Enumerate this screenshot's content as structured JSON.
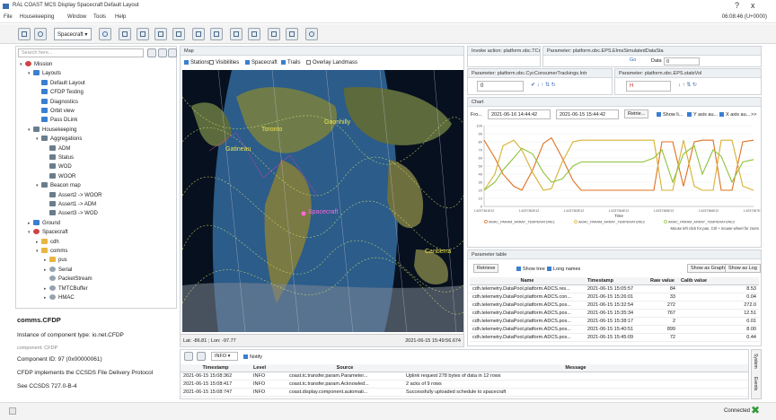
{
  "window": {
    "title": "RAL COAST MCS Display  Spacecraft  Default Layout",
    "clock": "06:08:46 (U+0000)",
    "controls": [
      "?",
      "x"
    ]
  },
  "menu": [
    "File",
    "Housekeeping",
    "Window",
    "Tools",
    "Help"
  ],
  "toolbar": {
    "spacecraft_select": "Spacecraft"
  },
  "nav": {
    "search_placeholder": "Search here...",
    "tree": [
      {
        "label": "Mission",
        "depth": 0,
        "icon": "mission",
        "tw": "▾"
      },
      {
        "label": "Layouts",
        "depth": 1,
        "icon": "folder",
        "tw": "▾"
      },
      {
        "label": "Default Layout",
        "depth": 2,
        "icon": "doc",
        "tw": ""
      },
      {
        "label": "CFDP Testing",
        "depth": 2,
        "icon": "doc",
        "tw": ""
      },
      {
        "label": "Diagnostics",
        "depth": 2,
        "icon": "doc",
        "tw": ""
      },
      {
        "label": "Orbit view",
        "depth": 2,
        "icon": "doc",
        "tw": ""
      },
      {
        "label": "Pass DLink",
        "depth": 2,
        "icon": "doc",
        "tw": ""
      },
      {
        "label": "Housekeeping",
        "depth": 1,
        "icon": "grid",
        "tw": "▾"
      },
      {
        "label": "Aggregations",
        "depth": 2,
        "icon": "grid",
        "tw": "▾"
      },
      {
        "label": "ADM",
        "depth": 3,
        "icon": "grid",
        "tw": ""
      },
      {
        "label": "Status",
        "depth": 3,
        "icon": "grid",
        "tw": ""
      },
      {
        "label": "WOD",
        "depth": 3,
        "icon": "grid",
        "tw": ""
      },
      {
        "label": "WOOR",
        "depth": 3,
        "icon": "grid",
        "tw": ""
      },
      {
        "label": "Beacon map",
        "depth": 2,
        "icon": "grid",
        "tw": "▾"
      },
      {
        "label": "Assert2 -> WOOR",
        "depth": 3,
        "icon": "grid",
        "tw": ""
      },
      {
        "label": "Assert1 -> ADM",
        "depth": 3,
        "icon": "grid",
        "tw": ""
      },
      {
        "label": "Assert3 -> WOD",
        "depth": 3,
        "icon": "grid",
        "tw": ""
      },
      {
        "label": "Ground",
        "depth": 1,
        "icon": "folder",
        "tw": "▸"
      },
      {
        "label": "Spacecraft",
        "depth": 1,
        "icon": "mission",
        "tw": "▾"
      },
      {
        "label": "cdh",
        "depth": 2,
        "icon": "folder-y",
        "tw": "▸"
      },
      {
        "label": "comms",
        "depth": 2,
        "icon": "folder-y",
        "tw": "▾"
      },
      {
        "label": "pus",
        "depth": 3,
        "icon": "folder-y",
        "tw": "▸"
      },
      {
        "label": "Serial",
        "depth": 3,
        "icon": "gear",
        "tw": "▸"
      },
      {
        "label": "PacketStream",
        "depth": 3,
        "icon": "gear",
        "tw": ""
      },
      {
        "label": "TMTCBuffer",
        "depth": 3,
        "icon": "gear",
        "tw": "▸"
      },
      {
        "label": "HMAC",
        "depth": 3,
        "icon": "gear",
        "tw": "▸"
      }
    ]
  },
  "description": {
    "title": "comms.CFDP",
    "lines": [
      "Instance of component type: io.net.CFDP",
      "component: CFDP",
      "Component ID: 97 (0x00000061)",
      "CFDP implements the CCSDS File Delivery Protocol",
      "See CCSDS 727.0-B-4"
    ]
  },
  "map": {
    "title": "Map",
    "checks": [
      {
        "label": "Stations",
        "on": true
      },
      {
        "label": "Visibilities",
        "on": false
      },
      {
        "label": "Spacecraft",
        "on": true
      },
      {
        "label": "Trails",
        "on": true
      },
      {
        "label": "Overlay Landmass",
        "on": false
      }
    ],
    "labels": [
      "Goonhilly",
      "Toronto",
      "Gatineau",
      "Spacecraft",
      "Canberra"
    ],
    "coords": "Lat: -86.81 ; Lon: -97.77",
    "timestamp": "2021-06-15 15:49:56.674"
  },
  "param_panels": {
    "top_left": "Invoke action: platform.obc.TCmeesd",
    "top_right": "Parameter: platform.obc.EPS.ElmsSimulatedDataSta",
    "p1": "Parameter: platform.obc.CycConsumerTrackings.Intr",
    "p2": "Parameter: platform.obc.EPS.statsVol",
    "p1_value": "0",
    "p2_value": "H",
    "data_label": "Data",
    "data_value": "0",
    "go_label": "Go"
  },
  "chart": {
    "title": "Chart",
    "from_label": "Fro...",
    "from": "2021-06-16 14:44:42",
    "to": "2021-06-15 15:44:42",
    "retrieve": "Retrie...",
    "opts": [
      "Show li...",
      "Y axis au...",
      "X axis au..."
    ],
    "more": ">>",
    "xlabel": "Time",
    "hint": "Mouse left click for pan, Ctrl + mouse wheel for zoom",
    "legend": [
      "AMAC_PARAM_ARRAY_TEMPERATURE1",
      "AMAC_PARAM_ARRAY_TEMPERATURE2",
      "AMAC_PARAM_ARRAY_TEMPERATURE3"
    ],
    "colors": [
      "#e07020",
      "#d8b030",
      "#8fc23a"
    ],
    "y_ticks": [
      "100",
      "90",
      "80",
      "70",
      "60",
      "50",
      "40",
      "30",
      "20",
      "10",
      "0"
    ],
    "x_ticks": [
      "1.6237361E12",
      "1.6237362E12",
      "1.6237363E12",
      "1.6237364E12",
      "1.6237365E12",
      "1.6237366E12",
      "1.6237367E12"
    ]
  },
  "chart_data": {
    "type": "line",
    "title": "",
    "xlabel": "Time",
    "ylabel": "",
    "ylim": [
      0,
      100
    ],
    "x": [
      0,
      4,
      7,
      11,
      14,
      18,
      22,
      25,
      29,
      33,
      36,
      40,
      44,
      48,
      52,
      56,
      59,
      63,
      66,
      70,
      74,
      78,
      81,
      85,
      88,
      92,
      96,
      100
    ],
    "series": [
      {
        "name": "AMAC_PARAM_ARRAY_TEMPERATURE1",
        "values": [
          82,
          60,
          40,
          25,
          20,
          45,
          78,
          85,
          60,
          32,
          20,
          20,
          20,
          20,
          20,
          20,
          20,
          20,
          80,
          80,
          25,
          80,
          82,
          82,
          20,
          20,
          80,
          82
        ]
      },
      {
        "name": "AMAC_PARAM_ARRAY_TEMPERATURE2",
        "values": [
          20,
          40,
          75,
          82,
          70,
          42,
          20,
          22,
          55,
          80,
          82,
          82,
          82,
          82,
          82,
          82,
          82,
          82,
          20,
          20,
          82,
          25,
          20,
          20,
          82,
          82,
          25,
          20
        ]
      },
      {
        "name": "AMAC_PARAM_ARRAY_TEMPERATURE3",
        "values": [
          20,
          30,
          45,
          60,
          72,
          65,
          42,
          30,
          34,
          50,
          55,
          55,
          55,
          55,
          55,
          55,
          55,
          60,
          70,
          30,
          65,
          75,
          40,
          70,
          62,
          30,
          55,
          58
        ]
      }
    ]
  },
  "ptable": {
    "title": "Parameter table",
    "retrieve": "Retrieve",
    "show_tree": "Show tree",
    "long_names": "Long names",
    "show_graph": "Show as Graph",
    "show_log": "Show as Log",
    "headers": [
      "Name",
      "Timestamp",
      "Raw value",
      "Calib value"
    ],
    "rows": [
      [
        "cdh.telemetry.DataPool.platform.ADCS.res...",
        "2021-06-15 15:05:57",
        "84",
        "8.53"
      ],
      [
        "cdh.telemetry.DataPool.platform.ADCS.con...",
        "2021-06-15 15:26:01",
        "33",
        "0.04"
      ],
      [
        "cdh.telemetry.DataPool.platform.ADCS.pos...",
        "2021-06-15 15:32:54",
        "272",
        "272.0"
      ],
      [
        "cdh.telemetry.DataPool.platform.ADCS.pos...",
        "2021-06-15 15:35:34",
        "767",
        "12.51"
      ],
      [
        "cdh.telemetry.DataPool.platform.ADCS.pos...",
        "2021-06-15 15:38:17",
        "2",
        "0.01"
      ],
      [
        "cdh.telemetry.DataPool.platform.ADCS.pos...",
        "2021-06-15 15:40:51",
        "899",
        "8.00"
      ],
      [
        "cdh.telemetry.DataPool.platform.ADCS.pos...",
        "2021-06-15 15:45:09",
        "72",
        "0.44"
      ]
    ]
  },
  "log": {
    "level_select": "INFO",
    "notify": "Notify",
    "headers": [
      "Timestamp",
      "Level",
      "Source",
      "Message"
    ],
    "rows": [
      [
        "2021-06-15 15:08:362",
        "INFO",
        "coast.tc.transfer.param.Parameter...",
        "Uplink request 278 bytes of data in 12 rows"
      ],
      [
        "2021-06-15 15:08:417",
        "INFO",
        "coast.tc.transfer.param.Acknowled...",
        "2 acks of 9 rows"
      ],
      [
        "2021-06-15 15:08:747",
        "INFO",
        "coast.display.component.automati...",
        "Successfully uploaded schedule to spacecraft"
      ]
    ],
    "side_tabs": [
      "System",
      "Events"
    ]
  },
  "status": {
    "text": "Connected"
  }
}
